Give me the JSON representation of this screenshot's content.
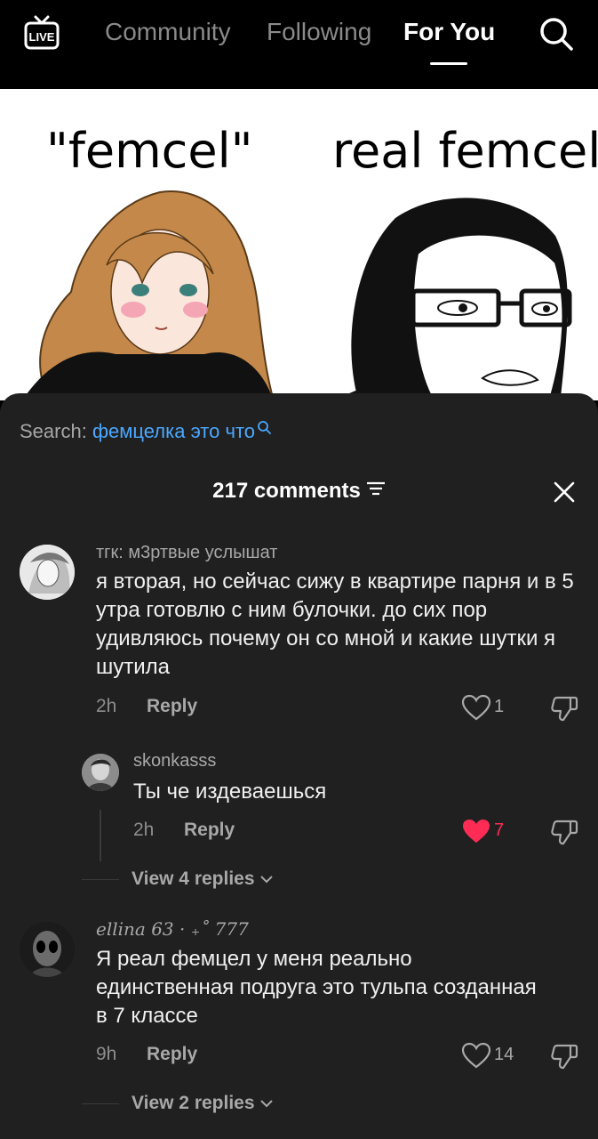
{
  "topbar": {
    "live_label": "LIVE",
    "tabs": [
      "Community",
      "Following",
      "For You"
    ],
    "active_tab": "For You"
  },
  "meme": {
    "left_caption": "\"femcel\"",
    "right_caption": "real femcel"
  },
  "sheet": {
    "search_label": "Search:",
    "search_query": "фемцелка это что",
    "comments_count": "217 comments",
    "comments": [
      {
        "username": "тгк: м3ртвые услышат",
        "text": "я вторая, но сейчас сижу в квартире парня и в 5 утра готовлю с ним булочки. до сих пор удивляюсь почему он со мной и какие шутки я шутила",
        "time": "2h",
        "reply_label": "Reply",
        "likes": "1",
        "liked": false
      },
      {
        "username": "skonkasss",
        "text": "Ты че издеваешься",
        "time": "2h",
        "reply_label": "Reply",
        "likes": "7",
        "liked": true
      },
      {
        "username": "ellina 63 · ₊˚ 777",
        "text": "Я реал фемцел у меня реально единственная подруга это тульпа созданная в 7 классе",
        "time": "9h",
        "reply_label": "Reply",
        "likes": "14",
        "liked": false
      }
    ],
    "view_replies_1": "View 4 replies",
    "view_replies_2": "View 2 replies"
  },
  "colors": {
    "accent_blue": "#4aa8ff",
    "like_red": "#fe2c55",
    "sheet_bg": "#202020"
  }
}
